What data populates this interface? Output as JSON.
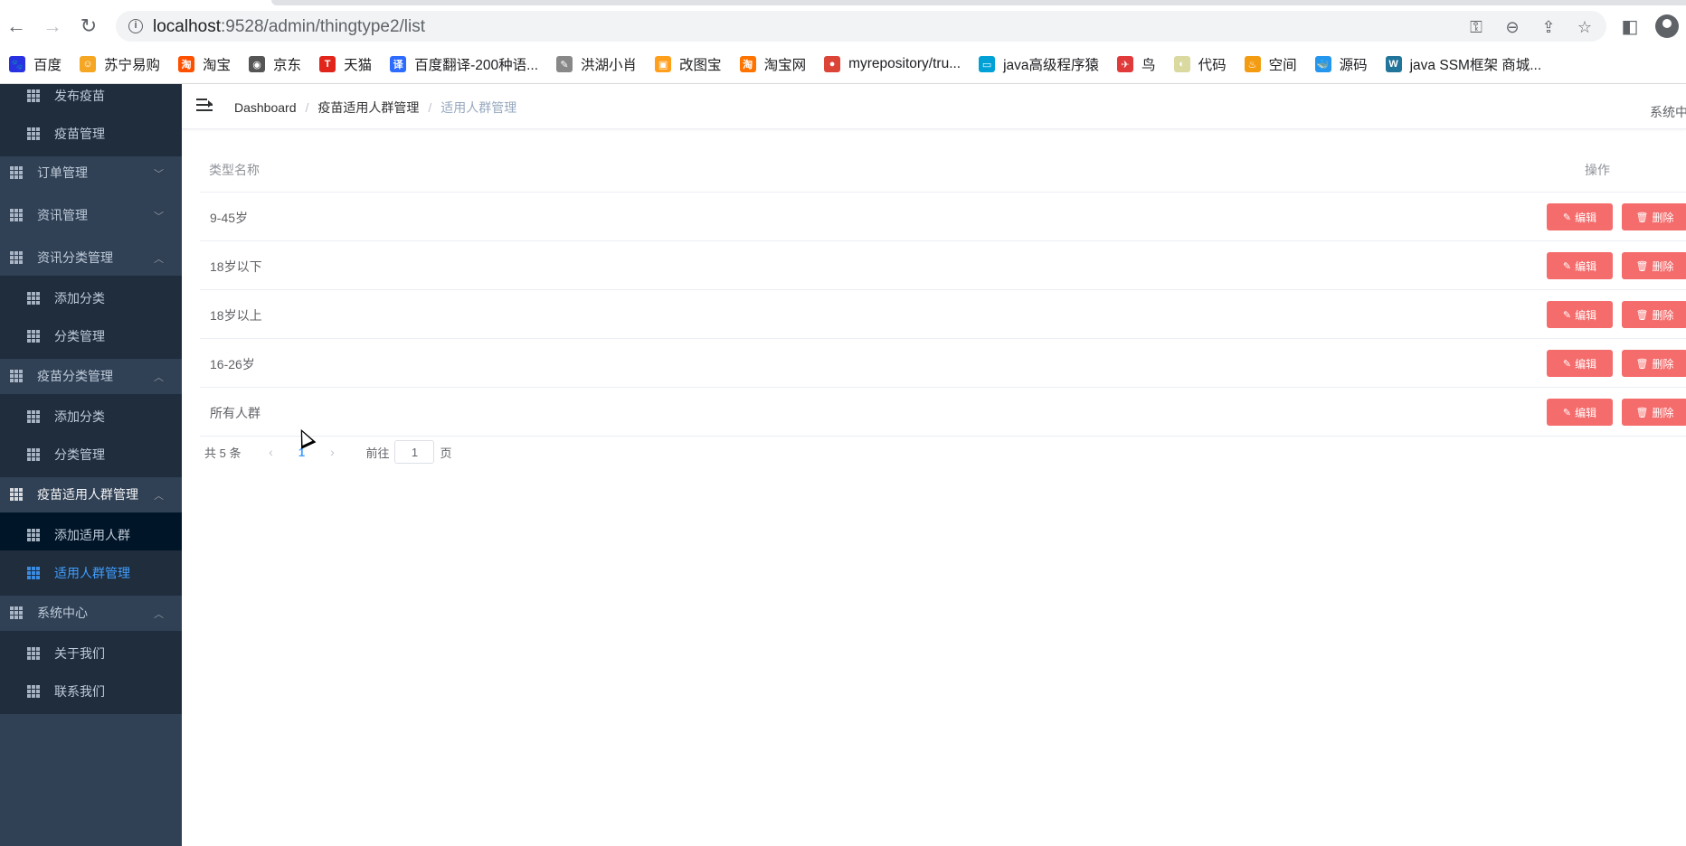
{
  "browser": {
    "url_host": "localhost",
    "url_path": ":9528/admin/thingtype2/list",
    "bookmarks": [
      {
        "label": "百度",
        "color": "#2932e1",
        "glyph": "🐾"
      },
      {
        "label": "苏宁易购",
        "color": "#f5a623",
        "glyph": "☺"
      },
      {
        "label": "淘宝",
        "color": "#ff5000",
        "glyph": "淘"
      },
      {
        "label": "京东",
        "color": "#555555",
        "glyph": "◉"
      },
      {
        "label": "天猫",
        "color": "#e1251b",
        "glyph": "T"
      },
      {
        "label": "百度翻译-200种语...",
        "color": "#2d6cff",
        "glyph": "译"
      },
      {
        "label": "洪湖小肖",
        "color": "#888888",
        "glyph": "✎"
      },
      {
        "label": "改图宝",
        "color": "#ff9f1c",
        "glyph": "▣"
      },
      {
        "label": "淘宝网",
        "color": "#ff7300",
        "glyph": "淘"
      },
      {
        "label": "myrepository/tru...",
        "color": "#db4437",
        "glyph": "●"
      },
      {
        "label": "java高级程序猿",
        "color": "#00a1d6",
        "glyph": "▭"
      },
      {
        "label": "鸟",
        "color": "#e03a3a",
        "glyph": "✈"
      },
      {
        "label": "代码",
        "color": "#d9d9a0",
        "glyph": "◐"
      },
      {
        "label": "空间",
        "color": "#f39c12",
        "glyph": "♨"
      },
      {
        "label": "源码",
        "color": "#2496ed",
        "glyph": "🐳"
      },
      {
        "label": "java SSM框架 商城...",
        "color": "#21759b",
        "glyph": "W"
      }
    ]
  },
  "sidebar": {
    "items": [
      {
        "label": "发布疫苗",
        "level": "sub"
      },
      {
        "label": "疫苗管理",
        "level": "sub"
      },
      {
        "label": "订单管理",
        "level": "top",
        "arrow": "﹀"
      },
      {
        "label": "资讯管理",
        "level": "top",
        "arrow": "﹀"
      },
      {
        "label": "资讯分类管理",
        "level": "top",
        "arrow": "︿"
      },
      {
        "label": "添加分类",
        "level": "sub"
      },
      {
        "label": "分类管理",
        "level": "sub"
      },
      {
        "label": "疫苗分类管理",
        "level": "top",
        "arrow": "︿"
      },
      {
        "label": "添加分类",
        "level": "sub"
      },
      {
        "label": "分类管理",
        "level": "sub"
      },
      {
        "label": "疫苗适用人群管理",
        "level": "top",
        "arrow": "︿"
      },
      {
        "label": "添加适用人群",
        "level": "sub"
      },
      {
        "label": "适用人群管理",
        "level": "sub"
      },
      {
        "label": "系统中心",
        "level": "top",
        "arrow": "︿"
      },
      {
        "label": "关于我们",
        "level": "sub"
      },
      {
        "label": "联系我们",
        "level": "sub"
      }
    ]
  },
  "navbar": {
    "breadcrumb": [
      "Dashboard",
      "疫苗适用人群管理",
      "适用人群管理"
    ],
    "right_text": "系统中"
  },
  "table": {
    "headers": {
      "name": "类型名称",
      "ops": "操作"
    },
    "rows": [
      {
        "name": "9-45岁"
      },
      {
        "name": "18岁以下"
      },
      {
        "name": "18岁以上"
      },
      {
        "name": "16-26岁"
      },
      {
        "name": "所有人群"
      }
    ],
    "edit_label": "编辑",
    "delete_label": "删除"
  },
  "pagination": {
    "total": "共 5 条",
    "current_page": "1",
    "goto_prefix": "前往",
    "goto_value": "1",
    "goto_suffix": "页"
  },
  "colors": {
    "sidebar_bg": "#304156",
    "submenu_bg": "#1f2d3d",
    "active": "#409eff",
    "danger": "#f56c6c"
  }
}
